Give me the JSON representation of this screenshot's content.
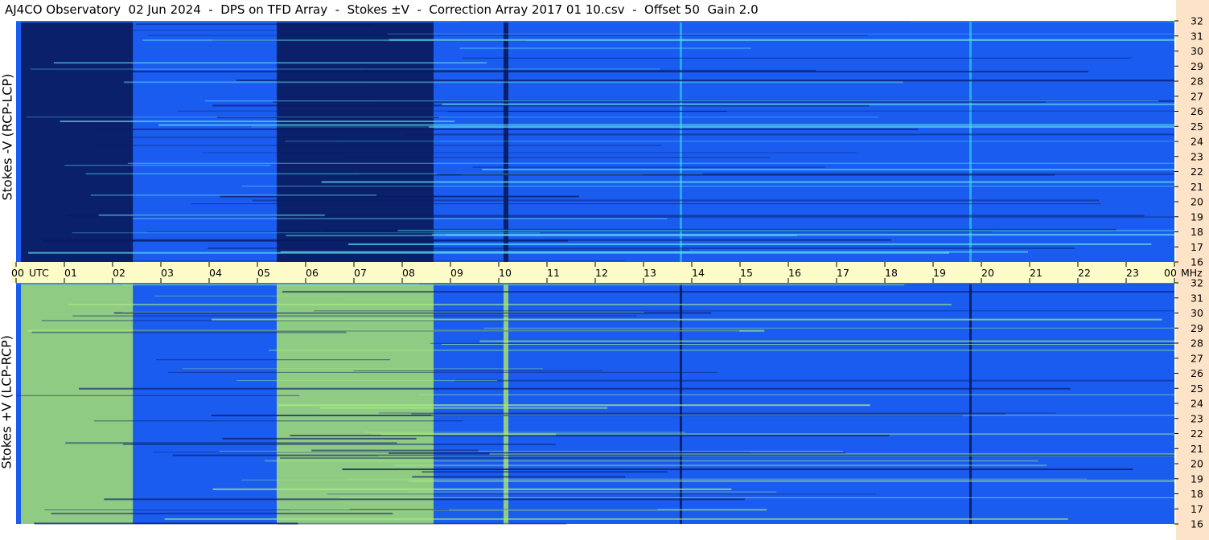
{
  "header": {
    "title": "AJ4CO Observatory  02 Jun 2024  -  DPS on TFD Array  -  Stokes ±V  -  Correction Array 2017 01 10.csv  -  Offset 50  Gain 2.0"
  },
  "colors": {
    "time_strip": "#fdfbc8",
    "freq_strip": "#fde3c8",
    "base_blue": "#1a5cf0",
    "dark_blue": "#06124a",
    "bright_cyan": "#26c8e8",
    "yellow_green": "#b8f060"
  },
  "chart_data": {
    "type": "heatmap",
    "panels": [
      {
        "name": "top",
        "ylabel": "Stokes -V (RCP-LCP)",
        "intensity_note": "dark bands = low",
        "time_bands_utc": [
          {
            "start": 0.1,
            "end": 2.42,
            "level": "dark"
          },
          {
            "start": 5.4,
            "end": 8.65,
            "level": "dark"
          },
          {
            "start": 10.1,
            "end": 10.2,
            "level": "dark"
          },
          {
            "start": 13.75,
            "end": 13.8,
            "level": "bright"
          },
          {
            "start": 19.75,
            "end": 19.8,
            "level": "bright"
          }
        ]
      },
      {
        "name": "bottom",
        "ylabel": "Stokes +V (LCP-RCP)",
        "time_bands_utc": [
          {
            "start": 0.1,
            "end": 2.42,
            "level": "bright"
          },
          {
            "start": 5.4,
            "end": 8.65,
            "level": "bright"
          },
          {
            "start": 10.1,
            "end": 10.2,
            "level": "bright"
          },
          {
            "start": 13.75,
            "end": 13.8,
            "level": "dark"
          },
          {
            "start": 19.75,
            "end": 19.8,
            "level": "dark"
          }
        ]
      }
    ],
    "x_ticks": [
      "00",
      "01",
      "02",
      "03",
      "04",
      "05",
      "06",
      "07",
      "08",
      "09",
      "10",
      "11",
      "12",
      "13",
      "14",
      "15",
      "16",
      "17",
      "18",
      "19",
      "20",
      "21",
      "22",
      "23",
      "00"
    ],
    "x_unit_label": "UTC",
    "x_range_hours": [
      0,
      24
    ],
    "y_ticks": [
      "16",
      "17",
      "18",
      "19",
      "20",
      "21",
      "22",
      "23",
      "24",
      "25",
      "26",
      "27",
      "28",
      "29",
      "30",
      "31",
      "32"
    ],
    "y_unit_label": "MHz",
    "y_range_mhz": [
      16,
      32
    ]
  }
}
